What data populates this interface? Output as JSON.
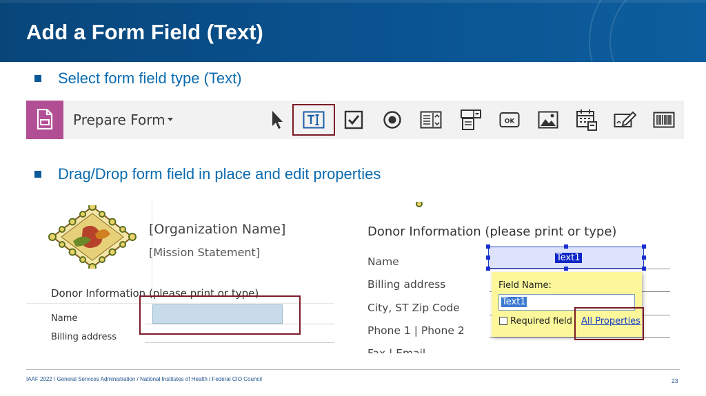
{
  "slide": {
    "title": "Add a Form Field (Text)",
    "bullets": [
      "Select form field type (Text)",
      "Drag/Drop form field in place and edit properties"
    ]
  },
  "toolbar": {
    "tool_name": "Prepare Form",
    "app_icon": "form-document-icon",
    "tools": [
      {
        "icon": "select-pointer-icon"
      },
      {
        "icon": "text-field-icon",
        "highlighted": true
      },
      {
        "icon": "checkbox-icon"
      },
      {
        "icon": "radio-button-icon"
      },
      {
        "icon": "list-box-icon"
      },
      {
        "icon": "dropdown-icon"
      },
      {
        "icon": "button-icon",
        "label": "OK"
      },
      {
        "icon": "image-field-icon"
      },
      {
        "icon": "date-field-icon"
      },
      {
        "icon": "digital-signature-icon"
      },
      {
        "icon": "barcode-icon"
      }
    ]
  },
  "left_form": {
    "org_name": "[Organization Name]",
    "mission": "[Mission Statement]",
    "donor_heading": "Donor Information (please print or type)",
    "rows": [
      "Name",
      "Billing address"
    ]
  },
  "right_form": {
    "donor_heading": "Donor Information (please print or type)",
    "rows": [
      "Name",
      "Billing address",
      "City, ST  Zip Code",
      "Phone 1 | Phone 2",
      "Fax | Email"
    ],
    "field_label": "Text1",
    "popup": {
      "field_name_label": "Field Name:",
      "field_name_value": "Text1",
      "required_label": "Required field",
      "required_checked": false,
      "all_properties_link": "All Properties"
    }
  },
  "footer": {
    "text": "IAAF 2022  /  General Services Administration  /  National Institutes of Health  /  Federal CIO Council",
    "page_number": "23"
  },
  "colors": {
    "header_blue": "#0a5391",
    "bullet_text": "#0a6bb0",
    "highlight_border": "#7b1a26",
    "app_tile": "#b24f94",
    "popup_yellow": "#fbf79a"
  }
}
